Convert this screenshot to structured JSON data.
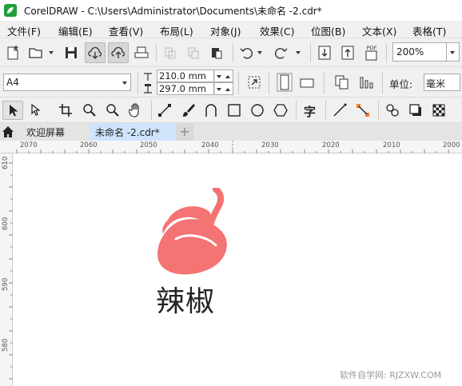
{
  "window": {
    "title": "CorelDRAW - C:\\Users\\Administrator\\Documents\\未命名 -2.cdr*"
  },
  "menu": [
    {
      "label": "文件(F)"
    },
    {
      "label": "编辑(E)"
    },
    {
      "label": "查看(V)"
    },
    {
      "label": "布局(L)"
    },
    {
      "label": "对象(J)"
    },
    {
      "label": "效果(C)"
    },
    {
      "label": "位图(B)"
    },
    {
      "label": "文本(X)"
    },
    {
      "label": "表格(T)"
    }
  ],
  "standard_toolbar": {
    "icons": [
      "new-document-icon",
      "open-icon",
      "save-icon",
      "cloud-download-icon",
      "cloud-upload-icon",
      "print-icon",
      "cut-icon",
      "copy-icon",
      "paste-icon",
      "undo-icon",
      "redo-icon",
      "import-icon",
      "export-icon",
      "pdf-icon"
    ],
    "pdf_label": "PDF",
    "zoom_value": "200%"
  },
  "property_bar": {
    "paper_size": "A4",
    "width_value": "210.0 mm",
    "height_value": "297.0 mm",
    "unit_label": "单位:",
    "unit_value": "毫米"
  },
  "toolbox": {
    "icons": [
      "pick-tool-icon",
      "shape-tool-icon",
      "crop-tool-icon",
      "zoom-tool-icon",
      "zoom-out-icon",
      "pan-tool-icon",
      "freehand-tool-icon",
      "artistic-media-icon",
      "bezier-icon",
      "rectangle-tool-icon",
      "ellipse-tool-icon",
      "polygon-tool-icon",
      "text-tool-icon",
      "line-tool-icon",
      "connector-tool-icon",
      "blend-tool-icon",
      "shadow-tool-icon",
      "transparency-tool-icon"
    ],
    "text_tool_glyph": "字"
  },
  "tabs": {
    "welcome": "欢迎屏幕",
    "document": "未命名 -2.cdr*",
    "add": "+"
  },
  "rulers": {
    "horizontal": [
      "2070",
      "2060",
      "2050",
      "2040",
      "2030",
      "2020",
      "2010",
      "2000"
    ],
    "vertical": [
      "610",
      "600",
      "590",
      "580"
    ]
  },
  "canvas": {
    "logo_text": "辣椒",
    "logo_color": "#f47373",
    "watermark": "软件自学网: RJZXW.COM"
  }
}
